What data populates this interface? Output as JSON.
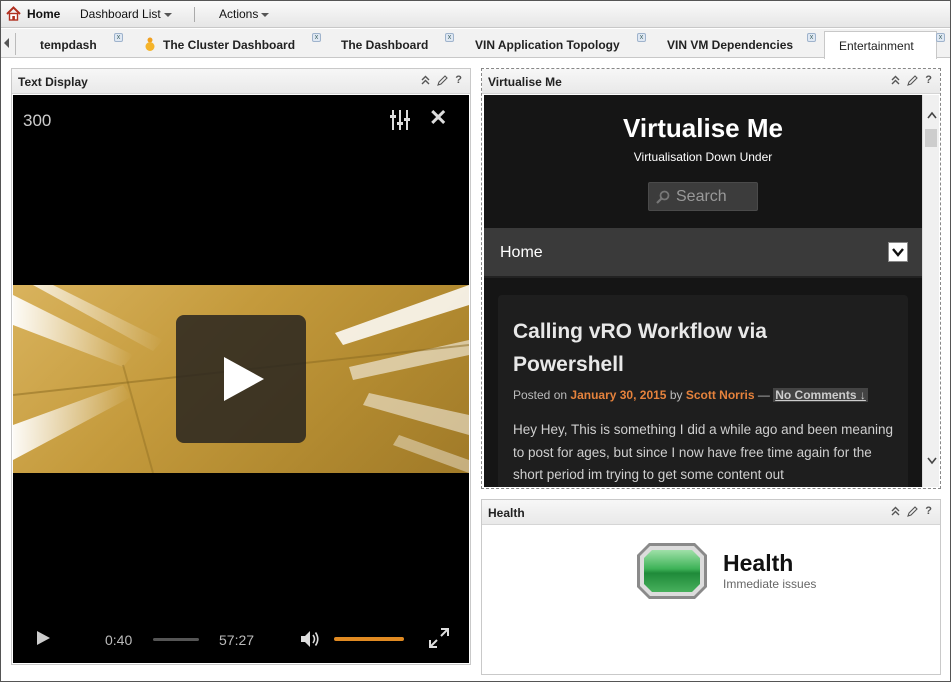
{
  "toolbar": {
    "home_label": "Home",
    "dashboard_list_label": "Dashboard List",
    "actions_label": "Actions"
  },
  "tabs": [
    {
      "label": "tempdash"
    },
    {
      "label": "The Cluster Dashboard"
    },
    {
      "label": "The Dashboard"
    },
    {
      "label": "VIN Application Topology"
    },
    {
      "label": "VIN VM Dependencies"
    },
    {
      "label": "Entertainment",
      "active": true
    }
  ],
  "text_display": {
    "title": "Text Display",
    "video": {
      "counter": "300",
      "current_time": "0:40",
      "duration": "57:27",
      "progress": 0.012,
      "volume": 1.0,
      "accent_color": "#e08a22"
    }
  },
  "virtualise_me": {
    "title": "Virtualise Me",
    "site_title": "Virtualise Me",
    "tagline": "Virtualisation Down Under",
    "search_placeholder": "Search",
    "nav_home": "Home",
    "post": {
      "title": "Calling vRO Workflow via Powershell",
      "posted_on": "Posted on",
      "date": "January 30, 2015",
      "by": "by",
      "author": "Scott Norris",
      "dash": "—",
      "comments": "No Comments ↓",
      "body": "Hey Hey, This is something I did a while ago and been meaning to post for ages, but since I now have free time again for the short period im trying to get some content out"
    }
  },
  "health": {
    "panel_title": "Health",
    "title": "Health",
    "subtitle": "Immediate issues"
  }
}
